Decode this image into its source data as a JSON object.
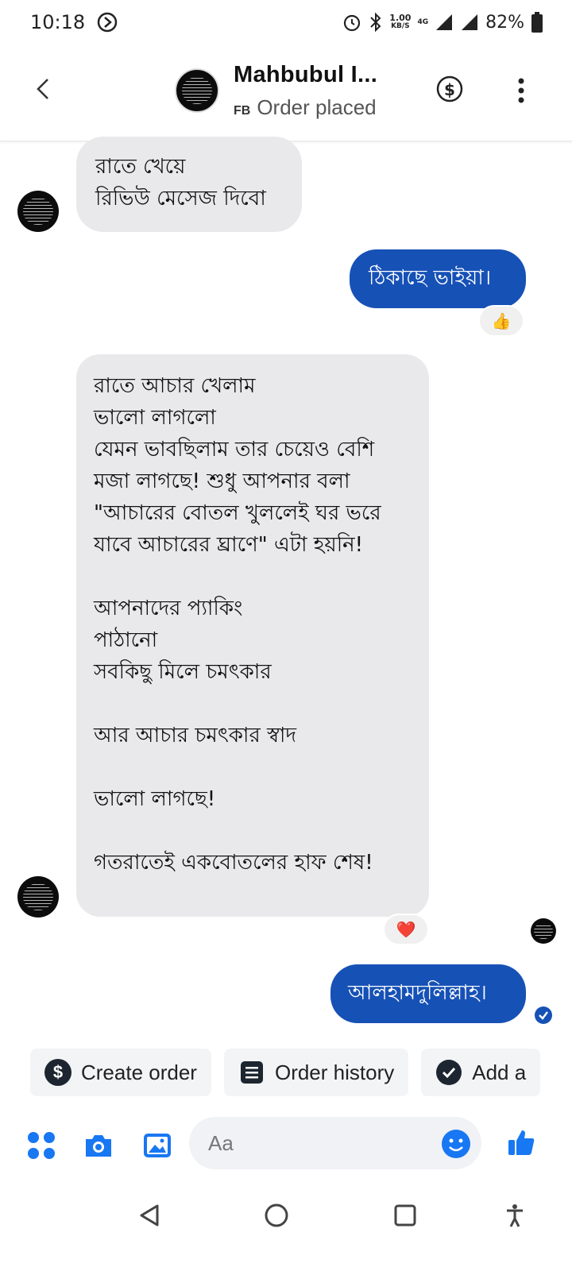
{
  "status_bar": {
    "time": "10:18",
    "speed_value": "1.00",
    "speed_unit": "KB/S",
    "network": "4G",
    "battery": "82%"
  },
  "header": {
    "name": "Mahbubul I...",
    "source_tag": "FB",
    "status": "Order placed"
  },
  "messages": [
    {
      "direction": "incoming",
      "lines": [
        "রাতে খেয়ে",
        "রিভিউ মেসেজ দিবো"
      ]
    },
    {
      "direction": "outgoing",
      "lines": [
        "ঠিকাছে ভাইয়া।"
      ],
      "reaction": "👍"
    },
    {
      "direction": "incoming",
      "lines": [
        "রাতে আচার খেলাম",
        "ভালো লাগলো",
        "যেমন ভাবছিলাম তার চেয়েও বেশি",
        "মজা লাগছে! শুধু আপনার বলা",
        "\"আচারের বোতল খুললেই ঘর ভরে",
        "যাবে আচারের ঘ্রাণে\" এটা হয়নি!",
        "",
        "আপনাদের প্যাকিং",
        "পাঠানো",
        "সবকিছু মিলে চমৎকার",
        "",
        "আর আচার চমৎকার স্বাদ",
        "",
        "ভালো লাগছে!",
        "",
        "গতরাতেই একবোতলের হাফ শেষ!"
      ],
      "reaction": "❤️"
    },
    {
      "direction": "outgoing",
      "lines": [
        "আলহামদুলিল্লাহ।"
      ]
    }
  ],
  "quick_actions": [
    {
      "label": "Create order",
      "icon": "dollar-icon"
    },
    {
      "label": "Order history",
      "icon": "list-icon"
    },
    {
      "label": "Add a",
      "icon": "check-icon"
    }
  ],
  "composer": {
    "placeholder": "Aa"
  },
  "colors": {
    "accent": "#1651b6",
    "incoming_bubble": "#e9e9eb",
    "icon_blue": "#1877f2"
  }
}
